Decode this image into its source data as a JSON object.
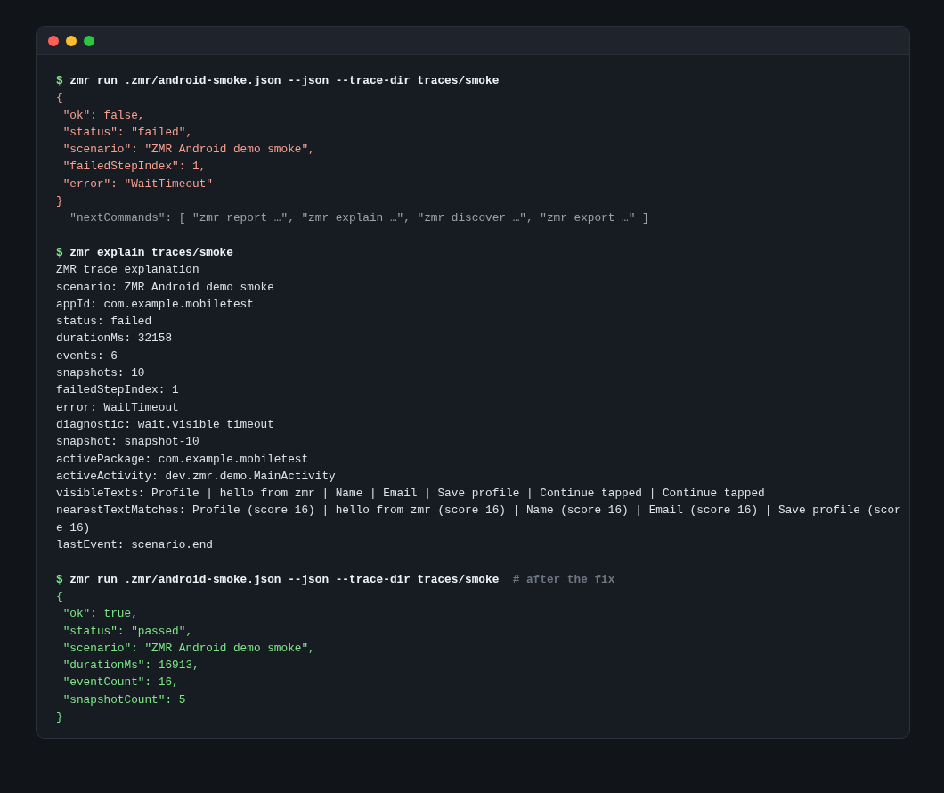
{
  "window": {
    "traffic_lights": [
      {
        "color": "#ff5f57"
      },
      {
        "color": "#febc2e"
      },
      {
        "color": "#28c840"
      }
    ]
  },
  "blocks": [
    {
      "prompt": "$",
      "command": "zmr run .zmr/android-smoke.json --json --trace-dir traces/smoke",
      "lines": [
        {
          "text": "{",
          "kind": "error"
        },
        {
          "text": " \"ok\": false,",
          "kind": "error"
        },
        {
          "text": " \"status\": \"failed\",",
          "kind": "error"
        },
        {
          "text": " \"scenario\": \"ZMR Android demo smoke\",",
          "kind": "error"
        },
        {
          "text": " \"failedStepIndex\": 1,",
          "kind": "error"
        },
        {
          "text": " \"error\": \"WaitTimeout\"",
          "kind": "error"
        },
        {
          "text": "}",
          "kind": "error"
        },
        {
          "text": "  \"nextCommands\": [ \"zmr report …\", \"zmr explain …\", \"zmr discover …\", \"zmr export …\" ]",
          "kind": "muted"
        }
      ]
    },
    {
      "prompt": "$",
      "command": "zmr explain traces/smoke",
      "lines": [
        {
          "text": "ZMR trace explanation",
          "kind": "plain"
        },
        {
          "text": "scenario: ZMR Android demo smoke",
          "kind": "plain"
        },
        {
          "text": "appId: com.example.mobiletest",
          "kind": "plain"
        },
        {
          "text": "status: failed",
          "kind": "plain"
        },
        {
          "text": "durationMs: 32158",
          "kind": "plain"
        },
        {
          "text": "events: 6",
          "kind": "plain"
        },
        {
          "text": "snapshots: 10",
          "kind": "plain"
        },
        {
          "text": "failedStepIndex: 1",
          "kind": "plain"
        },
        {
          "text": "error: WaitTimeout",
          "kind": "plain"
        },
        {
          "text": "diagnostic: wait.visible timeout",
          "kind": "plain"
        },
        {
          "text": "snapshot: snapshot-10",
          "kind": "plain"
        },
        {
          "text": "activePackage: com.example.mobiletest",
          "kind": "plain"
        },
        {
          "text": "activeActivity: dev.zmr.demo.MainActivity",
          "kind": "plain"
        },
        {
          "text": "visibleTexts: Profile | hello from zmr | Name | Email | Save profile | Continue tapped | Continue tapped",
          "kind": "plain"
        },
        {
          "text": "nearestTextMatches: Profile (score 16) | hello from zmr (score 16) | Name (score 16) | Email (score 16) | Save profile (score 16)",
          "kind": "plain"
        },
        {
          "text": "lastEvent: scenario.end",
          "kind": "plain"
        }
      ]
    },
    {
      "prompt": "$",
      "command": "zmr run .zmr/android-smoke.json --json --trace-dir traces/smoke",
      "comment": "# after the fix",
      "lines": [
        {
          "text": "{",
          "kind": "success"
        },
        {
          "text": " \"ok\": true,",
          "kind": "success"
        },
        {
          "text": " \"status\": \"passed\",",
          "kind": "success"
        },
        {
          "text": " \"scenario\": \"ZMR Android demo smoke\",",
          "kind": "success"
        },
        {
          "text": " \"durationMs\": 16913,",
          "kind": "success"
        },
        {
          "text": " \"eventCount\": 16,",
          "kind": "success"
        },
        {
          "text": " \"snapshotCount\": 5",
          "kind": "success"
        },
        {
          "text": "}",
          "kind": "success"
        }
      ]
    }
  ]
}
